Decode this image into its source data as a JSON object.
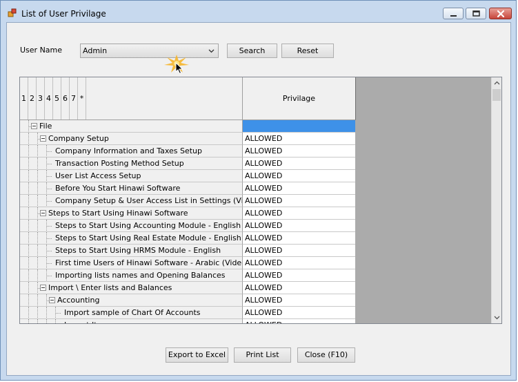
{
  "window": {
    "title": "List of User Privilage"
  },
  "filter": {
    "user_label": "User Name",
    "user_value": "Admin",
    "search_label": "Search",
    "reset_label": "Reset"
  },
  "grid": {
    "level_headers": [
      "1",
      "2",
      "3",
      "4",
      "5",
      "6",
      "7",
      "*"
    ],
    "privilege_header": "Privilage",
    "rows": [
      {
        "level": 0,
        "label": "File",
        "privilege": "",
        "expandable": true,
        "selected": true
      },
      {
        "level": 1,
        "label": "Company Setup",
        "privilege": "ALLOWED",
        "expandable": true
      },
      {
        "level": 2,
        "label": "Company Information and Taxes Setup",
        "privilege": "ALLOWED"
      },
      {
        "level": 2,
        "label": "Transaction Posting Method Setup",
        "privilege": "ALLOWED"
      },
      {
        "level": 2,
        "label": "User List Access Setup",
        "privilege": "ALLOWED"
      },
      {
        "level": 2,
        "label": "Before You Start Hinawi Software",
        "privilege": "ALLOWED"
      },
      {
        "level": 2,
        "label": "Company Setup & User Access List in Settings (Video)",
        "privilege": "ALLOWED"
      },
      {
        "level": 1,
        "label": "Steps to Start Using Hinawi Software",
        "privilege": "ALLOWED",
        "expandable": true
      },
      {
        "level": 2,
        "label": "Steps to Start Using Accounting Module - English",
        "privilege": "ALLOWED"
      },
      {
        "level": 2,
        "label": "Steps to Start Using Real Estate Module - English",
        "privilege": "ALLOWED"
      },
      {
        "level": 2,
        "label": "Steps to Start Using HRMS Module - English",
        "privilege": "ALLOWED"
      },
      {
        "level": 2,
        "label": "First time Users of Hinawi Software - Arabic (Video)",
        "privilege": "ALLOWED"
      },
      {
        "level": 2,
        "label": "Importing lists names and Opening Balances",
        "privilege": "ALLOWED"
      },
      {
        "level": 1,
        "label": "Import \\ Enter lists and Balances",
        "privilege": "ALLOWED",
        "expandable": true
      },
      {
        "level": 2,
        "label": "Accounting",
        "privilege": "ALLOWED",
        "expandable": true
      },
      {
        "level": 3,
        "label": "Import sample of Chart Of Accounts",
        "privilege": "ALLOWED"
      },
      {
        "level": 3,
        "label": "Import Items",
        "privilege": "ALLOWED"
      }
    ]
  },
  "footer": {
    "export_label": "Export to Excel",
    "print_label": "Print List",
    "close_label": "Close (F10)"
  },
  "colors": {
    "selection": "#3e91e8",
    "frame": "#c7d9ee",
    "close_button": "#c7453a"
  },
  "icons": {
    "app": "app-icon",
    "dropdown": "chevron-down-icon",
    "cursor": "mouse-pointer-icon"
  }
}
